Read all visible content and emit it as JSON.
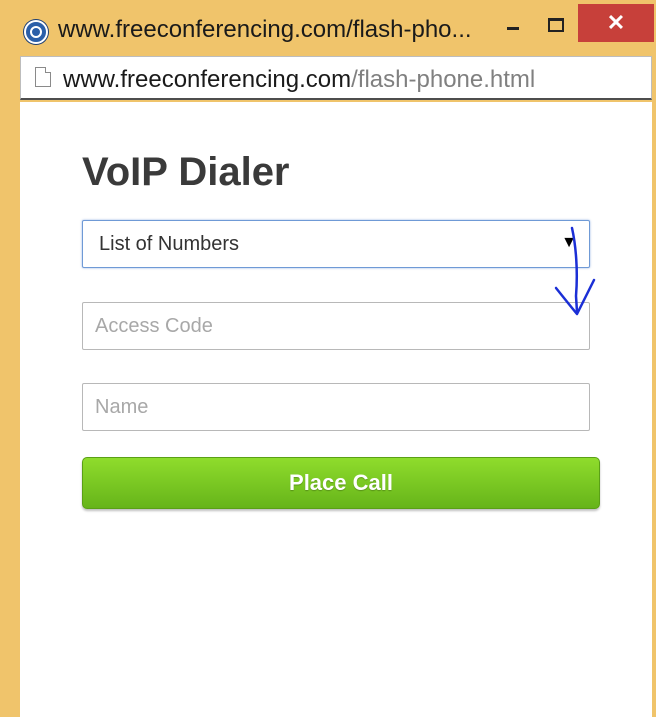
{
  "window": {
    "title": "www.freeconferencing.com/flash-pho...",
    "close_glyph": "✕",
    "accent_color": "#f0c46b",
    "close_color": "#c7403a"
  },
  "address": {
    "host": "www.freeconferencing.com",
    "path": "/flash-phone.html"
  },
  "dialer": {
    "title": "VoIP Dialer",
    "numbers_select": {
      "value": "List of Numbers",
      "caret": "▼"
    },
    "access_code": {
      "value": "",
      "placeholder": "Access Code"
    },
    "name": {
      "value": "",
      "placeholder": "Name"
    },
    "place_call_label": "Place Call",
    "button_color": "#7cc924"
  },
  "icons": {
    "app": "conference-logo-icon",
    "page": "page-icon",
    "minimize": "minimize-icon",
    "maximize": "maximize-icon",
    "close": "close-icon",
    "annotation": "hand-drawn-arrow-icon"
  }
}
